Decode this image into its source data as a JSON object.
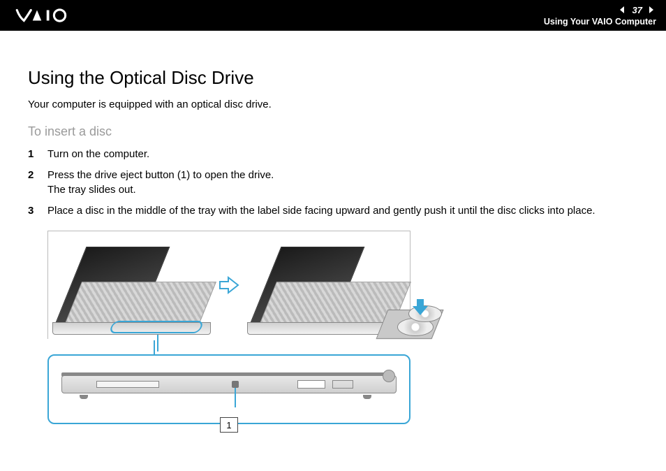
{
  "header": {
    "page_number": "37",
    "section": "Using Your VAIO Computer"
  },
  "title": "Using the Optical Disc Drive",
  "intro": "Your computer is equipped with an optical disc drive.",
  "subhead": "To insert a disc",
  "steps": [
    {
      "n": "1",
      "text": "Turn on the computer."
    },
    {
      "n": "2",
      "text": "Press the drive eject button (1) to open the drive.\nThe tray slides out."
    },
    {
      "n": "3",
      "text": "Place a disc in the middle of the tray with the label side facing upward and gently push it until the disc clicks into place."
    }
  ],
  "callout": {
    "label": "1"
  }
}
